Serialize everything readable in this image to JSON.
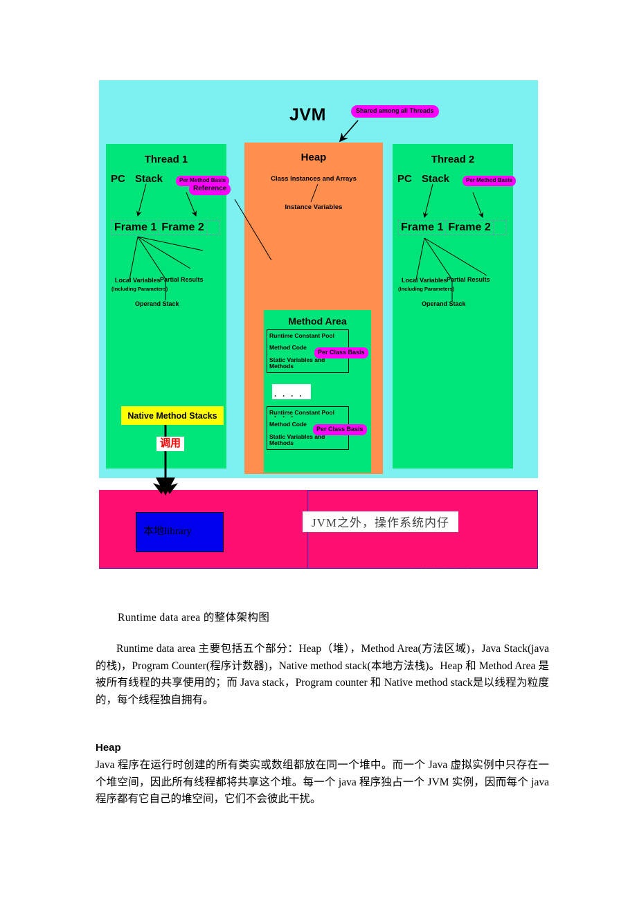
{
  "diagram": {
    "jvm_title": "JVM",
    "shared_badge": "Shared among all Threads",
    "threads": [
      {
        "title": "Thread 1",
        "pc": "PC",
        "stack": "Stack",
        "per_method_basis": "Per Method Basis",
        "frames": [
          "Frame 1",
          "Frame 2"
        ],
        "local_variables": "Local Variables",
        "local_variables_sub": "(Including Parameters)",
        "partial_results": "Partial Results",
        "operand_stack": "Operand Stack",
        "reference_badge": "Reference",
        "native_method_stacks": "Native Method Stacks",
        "call_label": "调用"
      },
      {
        "title": "Thread 2",
        "pc": "PC",
        "stack": "Stack",
        "per_method_basis": "Per Method Basis",
        "frames": [
          "Frame 1",
          "Frame 2"
        ],
        "local_variables": "Local Variables",
        "local_variables_sub": "(Including Parameters)",
        "partial_results": "Partial Results",
        "operand_stack": "Operand Stack"
      }
    ],
    "heap": {
      "title": "Heap",
      "class_instances": "Class Instances and Arrays",
      "instance_variables": "Instance Variables"
    },
    "method_area": {
      "title": "Method Area",
      "ellipsis": ". . . . . . .",
      "class_blocks": [
        {
          "runtime_constant_pool": "Runtime Constant Pool",
          "method_code": "Method Code",
          "static_variables": "Static Variables and Methods",
          "per_class_basis": "Per Class Basis"
        },
        {
          "runtime_constant_pool": "Runtime Constant Pool",
          "method_code": "Method Code",
          "static_variables": "Static Variables and Methods",
          "per_class_basis": "Per Class Basis"
        }
      ]
    },
    "os_area": {
      "dll_label": "本地library",
      "outside_jvm": "JVM之外，操作系统内仔",
      "faint_bottom": "· · · · · ·"
    },
    "colors": {
      "jvm_bg": "#7DF0F0",
      "thread_bg": "#00E57A",
      "heap_bg": "#FF8F4F",
      "method_area_bg": "#00E57A",
      "badge_magenta": "#FF00FF",
      "native_stack_yellow": "#FFFF00",
      "os_pink": "#FF0F72",
      "dll_blue": "#0000EE",
      "call_red": "#FF0000"
    }
  },
  "article": {
    "caption": "Runtime data area 的整体架构图",
    "paragraph1": "Runtime data area 主要包括五个部分：Heap（堆），Method Area(方法区域)，Java Stack(java 的栈)，Program Counter(程序计数器)，Native method stack(本地方法栈)。Heap 和 Method Area 是被所有线程的共享使用的；而 Java stack，Program counter 和 Native method stack是以线程为粒度的，每个线程独自拥有。",
    "heap_heading": "Heap",
    "paragraph2": "Java 程序在运行时创建的所有类实或数组都放在同一个堆中。而一个 Java 虚拟实例中只存在一个堆空间，因此所有线程都将共享这个堆。每一个 java 程序独占一个 JVM 实例，因而每个 java 程序都有它自己的堆空间，它们不会彼此干扰。"
  }
}
